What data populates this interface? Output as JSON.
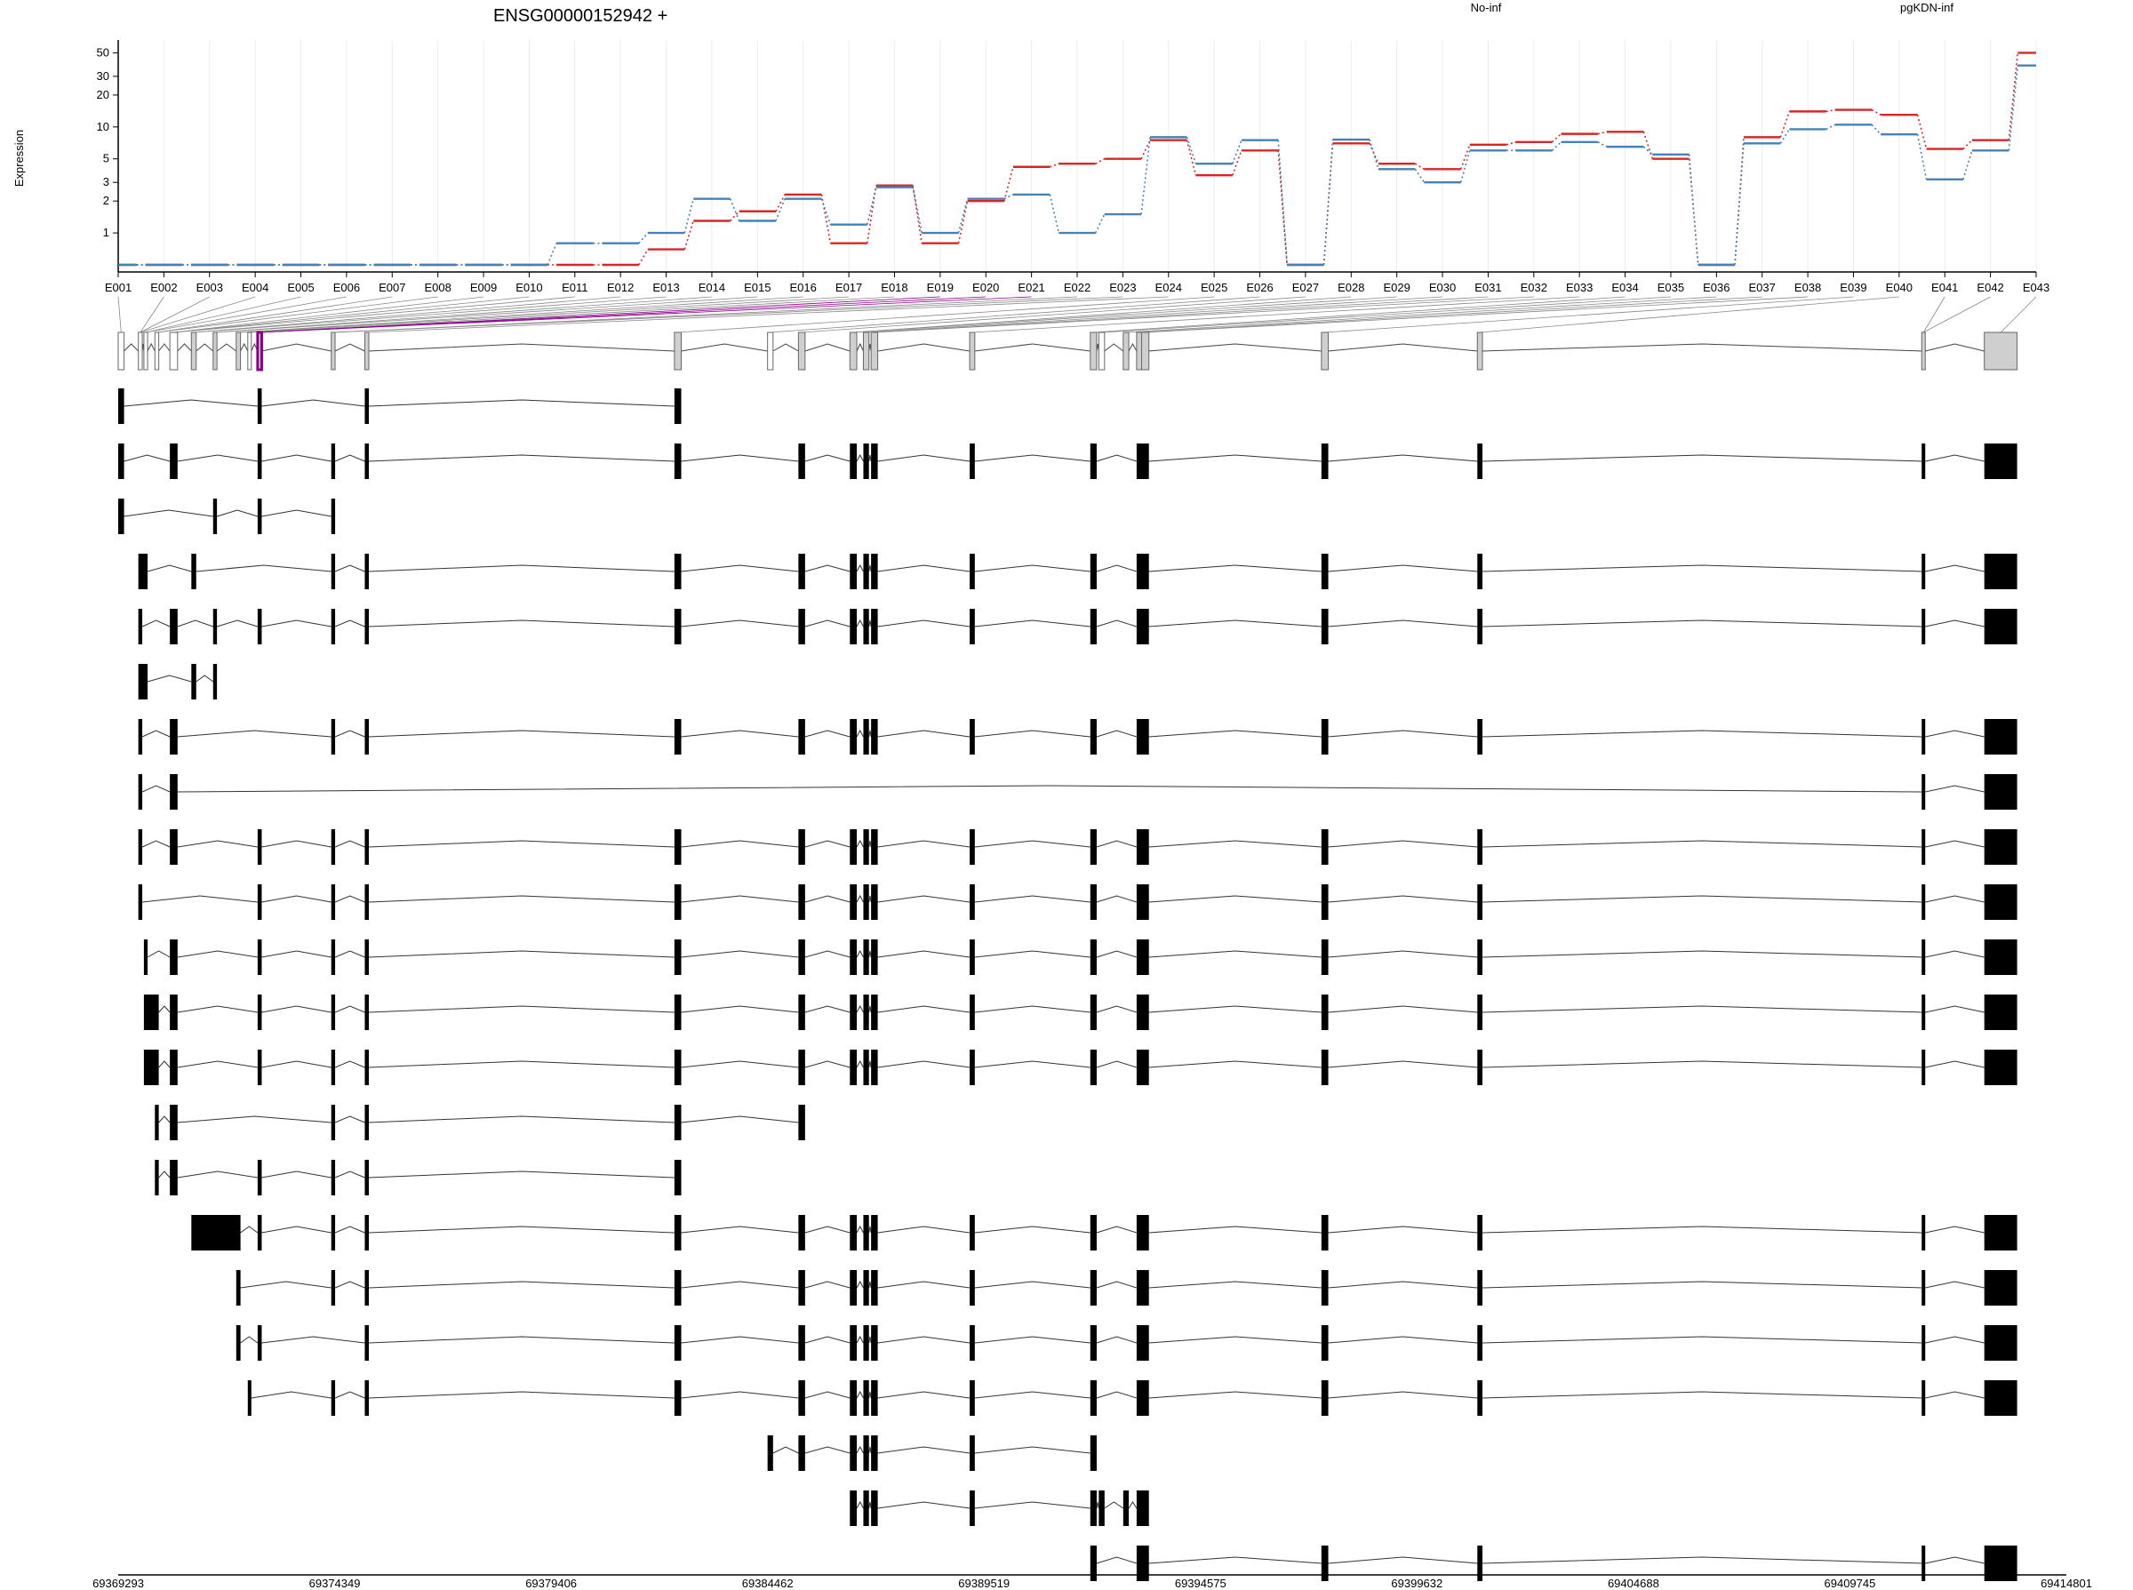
{
  "chart_data": {
    "type": "line",
    "title": "ENSG00000152942 +",
    "ylabel": "Expression",
    "yscale": "log",
    "y_ticks": [
      "1",
      "2",
      "3",
      "5",
      "10",
      "20",
      "30",
      "50"
    ],
    "y_tick_values": [
      1,
      2,
      3,
      5,
      10,
      20,
      30,
      50
    ],
    "grid": "vertical",
    "legend": "top-right",
    "categories": [
      "E001",
      "E002",
      "E003",
      "E004",
      "E005",
      "E006",
      "E007",
      "E008",
      "E009",
      "E010",
      "E011",
      "E012",
      "E013",
      "E014",
      "E015",
      "E016",
      "E017",
      "E018",
      "E019",
      "E020",
      "E021",
      "E022",
      "E023",
      "E024",
      "E025",
      "E026",
      "E027",
      "E028",
      "E029",
      "E030",
      "E031",
      "E032",
      "E033",
      "E034",
      "E035",
      "E036",
      "E037",
      "E038",
      "E039",
      "E040",
      "E041",
      "E042",
      "E043"
    ],
    "series": [
      {
        "name": "No-inf",
        "color": "#d62728",
        "values": [
          0.5,
          0.5,
          0.5,
          0.5,
          0.5,
          0.5,
          0.5,
          0.5,
          0.5,
          0.5,
          0.5,
          0.5,
          0.7,
          1.3,
          1.6,
          2.3,
          0.8,
          2.8,
          0.8,
          2.0,
          4.2,
          4.5,
          5.0,
          7.5,
          3.5,
          6.0,
          0.5,
          7.0,
          4.5,
          4.0,
          6.8,
          7.2,
          8.6,
          9.0,
          5.0,
          0.5,
          8.0,
          14.0,
          14.5,
          13.0,
          6.2,
          7.5,
          50.0
        ]
      },
      {
        "name": "pgKDN-inf",
        "color": "#4682b4",
        "values": [
          0.5,
          0.5,
          0.5,
          0.5,
          0.5,
          0.5,
          0.5,
          0.5,
          0.5,
          0.5,
          0.8,
          0.8,
          1.0,
          2.1,
          1.3,
          2.1,
          1.2,
          2.7,
          1.0,
          2.1,
          2.3,
          1.0,
          1.5,
          8.0,
          4.5,
          7.5,
          0.5,
          7.6,
          4.0,
          3.0,
          6.0,
          6.0,
          7.2,
          6.5,
          5.5,
          0.5,
          7.0,
          9.5,
          10.5,
          8.5,
          3.2,
          6.0,
          38.0
        ]
      }
    ],
    "genomic_axis_ticks": [
      "69369293",
      "69374349",
      "69379406",
      "69384462",
      "69389519",
      "69394575",
      "69399632",
      "69404688",
      "69409745",
      "69414801"
    ],
    "genomic_range": [
      69369293,
      69414801
    ],
    "exon_starts": [
      69369293,
      69369764,
      69369893,
      69370150,
      69370500,
      69371002,
      69371510,
      69372050,
      69372320,
      69372550,
      69374270,
      69375053,
      69382286,
      69384462,
      69385183,
      69386385,
      69386700,
      69386880,
      69389183,
      69392001,
      69392200,
      69392770,
      69393083,
      69393200,
      69397400,
      69401042,
      69411422,
      69412885
    ],
    "exon_ends": [
      69369430,
      69369855,
      69369980,
      69370240,
      69370680,
      69371115,
      69371600,
      69372150,
      69372400,
      69372645,
      69374360,
      69375148,
      69382445,
      69384590,
      69385338,
      69386546,
      69386830,
      69387035,
      69389303,
      69392150,
      69392334,
      69392900,
      69393225,
      69393370,
      69397560,
      69401161,
      69411485,
      69413651
    ],
    "aggregate_exon_fill": [
      "white",
      "white",
      "white",
      "white",
      "white",
      "grey",
      "grey",
      "grey",
      "white",
      "grey",
      "grey",
      "grey",
      "grey",
      "white",
      "grey",
      "grey",
      "grey",
      "grey",
      "grey",
      "grey",
      "white",
      "grey",
      "grey",
      "grey",
      "grey",
      "grey",
      "grey",
      "grey"
    ],
    "highlight_exon_index": 9,
    "highlight_color": "#8b008b",
    "transcripts": [
      [
        [
          0,
          0
        ],
        [
          9,
          9
        ],
        [
          11,
          11
        ],
        [
          12,
          12
        ]
      ],
      [
        [
          0,
          0
        ],
        [
          4,
          4
        ],
        [
          9,
          9
        ],
        [
          10,
          10
        ],
        [
          11,
          11
        ],
        [
          12,
          12
        ],
        [
          14,
          14
        ],
        [
          15,
          15
        ],
        [
          16,
          16
        ],
        [
          17,
          17
        ],
        [
          18,
          18
        ],
        [
          19,
          19
        ],
        [
          22,
          22
        ],
        [
          23,
          23
        ],
        [
          24,
          24
        ],
        [
          25,
          25
        ],
        [
          26,
          26
        ],
        [
          27,
          27
        ]
      ],
      [
        [
          0,
          0
        ],
        [
          6,
          6
        ],
        [
          9,
          9
        ],
        [
          10,
          10
        ]
      ],
      [
        [
          1,
          2
        ],
        [
          5,
          5
        ],
        [
          10,
          10
        ],
        [
          11,
          11
        ],
        [
          12,
          12
        ],
        [
          14,
          14
        ],
        [
          15,
          15
        ],
        [
          16,
          16
        ],
        [
          17,
          17
        ],
        [
          18,
          18
        ],
        [
          19,
          19
        ],
        [
          22,
          22
        ],
        [
          23,
          23
        ],
        [
          24,
          24
        ],
        [
          25,
          25
        ],
        [
          26,
          26
        ],
        [
          27,
          27
        ]
      ],
      [
        [
          1,
          1
        ],
        [
          4,
          4
        ],
        [
          6,
          6
        ],
        [
          9,
          9
        ],
        [
          10,
          10
        ],
        [
          11,
          11
        ],
        [
          12,
          12
        ],
        [
          14,
          14
        ],
        [
          15,
          15
        ],
        [
          16,
          16
        ],
        [
          17,
          17
        ],
        [
          18,
          18
        ],
        [
          19,
          19
        ],
        [
          22,
          22
        ],
        [
          23,
          23
        ],
        [
          24,
          24
        ],
        [
          25,
          25
        ],
        [
          26,
          26
        ],
        [
          27,
          27
        ]
      ],
      [
        [
          1,
          2
        ],
        [
          5,
          5
        ],
        [
          6,
          6
        ]
      ],
      [
        [
          1,
          1
        ],
        [
          4,
          4
        ],
        [
          10,
          10
        ],
        [
          11,
          11
        ],
        [
          12,
          12
        ],
        [
          14,
          14
        ],
        [
          15,
          15
        ],
        [
          16,
          16
        ],
        [
          17,
          17
        ],
        [
          18,
          18
        ],
        [
          19,
          19
        ],
        [
          22,
          22
        ],
        [
          23,
          23
        ],
        [
          24,
          24
        ],
        [
          25,
          25
        ],
        [
          26,
          26
        ],
        [
          27,
          27
        ]
      ],
      [
        [
          1,
          1
        ],
        [
          4,
          4
        ],
        [
          26,
          26
        ],
        [
          27,
          27
        ]
      ],
      [
        [
          1,
          1
        ],
        [
          4,
          4
        ],
        [
          9,
          9
        ],
        [
          10,
          10
        ],
        [
          11,
          11
        ],
        [
          12,
          12
        ],
        [
          14,
          14
        ],
        [
          15,
          15
        ],
        [
          16,
          16
        ],
        [
          17,
          17
        ],
        [
          18,
          18
        ],
        [
          19,
          19
        ],
        [
          22,
          22
        ],
        [
          23,
          23
        ],
        [
          24,
          24
        ],
        [
          25,
          25
        ],
        [
          26,
          26
        ],
        [
          27,
          27
        ]
      ],
      [
        [
          1,
          1
        ],
        [
          9,
          9
        ],
        [
          10,
          10
        ],
        [
          11,
          11
        ],
        [
          12,
          12
        ],
        [
          14,
          14
        ],
        [
          15,
          15
        ],
        [
          16,
          16
        ],
        [
          17,
          17
        ],
        [
          18,
          18
        ],
        [
          19,
          19
        ],
        [
          22,
          22
        ],
        [
          23,
          23
        ],
        [
          24,
          24
        ],
        [
          25,
          25
        ],
        [
          26,
          26
        ],
        [
          27,
          27
        ]
      ],
      [
        [
          2,
          2
        ],
        [
          4,
          4
        ],
        [
          9,
          9
        ],
        [
          10,
          10
        ],
        [
          11,
          11
        ],
        [
          12,
          12
        ],
        [
          14,
          14
        ],
        [
          15,
          15
        ],
        [
          16,
          16
        ],
        [
          17,
          17
        ],
        [
          18,
          18
        ],
        [
          19,
          19
        ],
        [
          22,
          22
        ],
        [
          23,
          23
        ],
        [
          24,
          24
        ],
        [
          25,
          25
        ],
        [
          26,
          26
        ],
        [
          27,
          27
        ]
      ],
      [
        [
          2,
          3
        ],
        [
          4,
          4
        ],
        [
          9,
          9
        ],
        [
          10,
          10
        ],
        [
          11,
          11
        ],
        [
          12,
          12
        ],
        [
          14,
          14
        ],
        [
          15,
          15
        ],
        [
          16,
          16
        ],
        [
          17,
          17
        ],
        [
          18,
          18
        ],
        [
          19,
          19
        ],
        [
          22,
          22
        ],
        [
          23,
          23
        ],
        [
          24,
          24
        ],
        [
          25,
          25
        ],
        [
          26,
          26
        ],
        [
          27,
          27
        ]
      ],
      [
        [
          2,
          3
        ],
        [
          4,
          4
        ],
        [
          9,
          9
        ],
        [
          10,
          10
        ],
        [
          11,
          11
        ],
        [
          12,
          12
        ],
        [
          14,
          14
        ],
        [
          15,
          15
        ],
        [
          16,
          16
        ],
        [
          17,
          17
        ],
        [
          18,
          18
        ],
        [
          19,
          19
        ],
        [
          22,
          22
        ],
        [
          23,
          23
        ],
        [
          24,
          24
        ],
        [
          25,
          25
        ],
        [
          26,
          26
        ],
        [
          27,
          27
        ]
      ],
      [
        [
          3,
          3
        ],
        [
          4,
          4
        ],
        [
          10,
          10
        ],
        [
          11,
          11
        ],
        [
          12,
          12
        ],
        [
          14,
          14
        ]
      ],
      [
        [
          3,
          3
        ],
        [
          4,
          4
        ],
        [
          9,
          9
        ],
        [
          10,
          10
        ],
        [
          11,
          11
        ],
        [
          12,
          12
        ]
      ],
      [
        [
          5,
          7
        ],
        [
          9,
          9
        ],
        [
          10,
          10
        ],
        [
          11,
          11
        ],
        [
          12,
          12
        ],
        [
          14,
          14
        ],
        [
          15,
          15
        ],
        [
          16,
          16
        ],
        [
          17,
          17
        ],
        [
          18,
          18
        ],
        [
          19,
          19
        ],
        [
          22,
          22
        ],
        [
          23,
          23
        ],
        [
          24,
          24
        ],
        [
          25,
          25
        ],
        [
          26,
          26
        ],
        [
          27,
          27
        ]
      ],
      [
        [
          7,
          7
        ],
        [
          10,
          10
        ],
        [
          11,
          11
        ],
        [
          12,
          12
        ],
        [
          14,
          14
        ],
        [
          15,
          15
        ],
        [
          16,
          16
        ],
        [
          17,
          17
        ],
        [
          18,
          18
        ],
        [
          19,
          19
        ],
        [
          22,
          22
        ],
        [
          23,
          23
        ],
        [
          24,
          24
        ],
        [
          25,
          25
        ],
        [
          26,
          26
        ],
        [
          27,
          27
        ]
      ],
      [
        [
          7,
          7
        ],
        [
          9,
          9
        ],
        [
          11,
          11
        ],
        [
          12,
          12
        ],
        [
          14,
          14
        ],
        [
          15,
          15
        ],
        [
          16,
          16
        ],
        [
          17,
          17
        ],
        [
          18,
          18
        ],
        [
          19,
          19
        ],
        [
          22,
          22
        ],
        [
          23,
          23
        ],
        [
          24,
          24
        ],
        [
          25,
          25
        ],
        [
          26,
          26
        ],
        [
          27,
          27
        ]
      ],
      [
        [
          8,
          8
        ],
        [
          10,
          10
        ],
        [
          11,
          11
        ],
        [
          12,
          12
        ],
        [
          14,
          14
        ],
        [
          15,
          15
        ],
        [
          16,
          16
        ],
        [
          17,
          17
        ],
        [
          18,
          18
        ],
        [
          19,
          19
        ],
        [
          22,
          22
        ],
        [
          23,
          23
        ],
        [
          24,
          24
        ],
        [
          25,
          25
        ],
        [
          26,
          26
        ],
        [
          27,
          27
        ]
      ],
      [
        [
          13,
          13
        ],
        [
          14,
          14
        ],
        [
          15,
          15
        ],
        [
          16,
          16
        ],
        [
          17,
          17
        ],
        [
          18,
          18
        ],
        [
          19,
          19
        ]
      ],
      [
        [
          15,
          15
        ],
        [
          16,
          16
        ],
        [
          17,
          17
        ],
        [
          18,
          18
        ],
        [
          19,
          19
        ],
        [
          20,
          20
        ],
        [
          21,
          21
        ],
        [
          22,
          22
        ],
        [
          23,
          23
        ]
      ],
      [
        [
          19,
          19
        ],
        [
          22,
          22
        ],
        [
          23,
          23
        ],
        [
          24,
          24
        ],
        [
          25,
          25
        ],
        [
          26,
          26
        ],
        [
          27,
          27
        ]
      ]
    ]
  }
}
